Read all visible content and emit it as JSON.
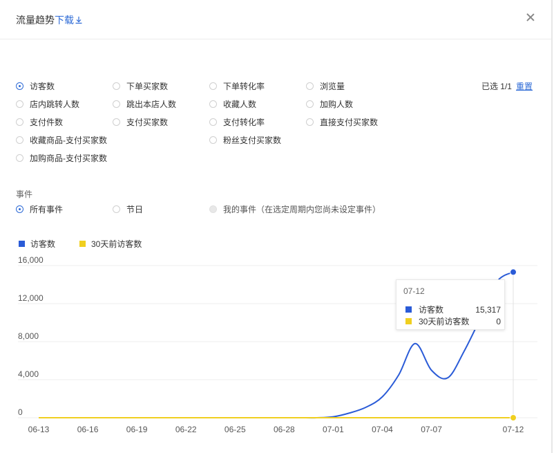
{
  "dialog": {
    "title": "流量趋势",
    "download_link": "下载",
    "close_label": "×"
  },
  "metrics": {
    "options": [
      {
        "label": "访客数",
        "checked": true
      },
      {
        "label": "下单买家数",
        "checked": false
      },
      {
        "label": "下单转化率",
        "checked": false
      },
      {
        "label": "浏览量",
        "checked": false
      },
      {
        "label": "店内跳转人数",
        "checked": false
      },
      {
        "label": "跳出本店人数",
        "checked": false
      },
      {
        "label": "收藏人数",
        "checked": false
      },
      {
        "label": "加购人数",
        "checked": false
      },
      {
        "label": "支付件数",
        "checked": false
      },
      {
        "label": "支付买家数",
        "checked": false
      },
      {
        "label": "支付转化率",
        "checked": false
      },
      {
        "label": "直接支付买家数",
        "checked": false
      },
      {
        "label": "收藏商品-支付买家数",
        "checked": false
      },
      {
        "label": "粉丝支付买家数",
        "checked": false
      },
      {
        "label": "加购商品-支付买家数",
        "checked": false
      }
    ],
    "selected_text": "已选 1/1",
    "reset_label": "重置"
  },
  "events": {
    "section_label": "事件",
    "options": [
      {
        "label": "所有事件",
        "checked": true
      },
      {
        "label": "节日",
        "checked": false
      },
      {
        "label": "我的事件（在选定周期内您尚未设定事件）",
        "checked": false,
        "disabled": true
      }
    ]
  },
  "colors": {
    "accent": "#2d6ad6",
    "series_visitors": "#2a5bd7",
    "series_prev": "#f0cf1f"
  },
  "legend": {
    "series1": "访客数",
    "series2": "30天前访客数"
  },
  "tooltip": {
    "date": "07-12",
    "rows": [
      {
        "label": "访客数",
        "value": "15,317"
      },
      {
        "label": "30天前访客数",
        "value": "0"
      }
    ]
  },
  "chart_data": {
    "type": "line",
    "x": [
      "06-13",
      "06-14",
      "06-15",
      "06-16",
      "06-17",
      "06-18",
      "06-19",
      "06-20",
      "06-21",
      "06-22",
      "06-23",
      "06-24",
      "06-25",
      "06-26",
      "06-27",
      "06-28",
      "06-29",
      "06-30",
      "07-01",
      "07-02",
      "07-03",
      "07-04",
      "07-05",
      "07-06",
      "07-07",
      "07-08",
      "07-09",
      "07-10",
      "07-11",
      "07-12"
    ],
    "x_tick_labels": [
      "06-13",
      "06-16",
      "06-19",
      "06-22",
      "06-25",
      "06-28",
      "07-01",
      "07-04",
      "07-07",
      "07-12"
    ],
    "y_tick_labels": [
      "16,000",
      "12,000",
      "8,000",
      "4,000",
      "0"
    ],
    "ylim": [
      0,
      16000
    ],
    "series": [
      {
        "name": "访客数",
        "values": [
          0,
          0,
          0,
          0,
          0,
          0,
          0,
          0,
          0,
          0,
          0,
          0,
          0,
          0,
          0,
          0,
          0,
          0,
          100,
          500,
          1100,
          2200,
          4500,
          7800,
          5000,
          4200,
          7000,
          10500,
          14300,
          15317
        ]
      },
      {
        "name": "30天前访客数",
        "values": [
          0,
          0,
          0,
          0,
          0,
          0,
          0,
          0,
          0,
          0,
          0,
          0,
          0,
          0,
          0,
          0,
          0,
          0,
          0,
          0,
          0,
          0,
          0,
          0,
          0,
          0,
          0,
          0,
          0,
          0
        ]
      }
    ],
    "highlight_index": 29,
    "grid": true
  }
}
